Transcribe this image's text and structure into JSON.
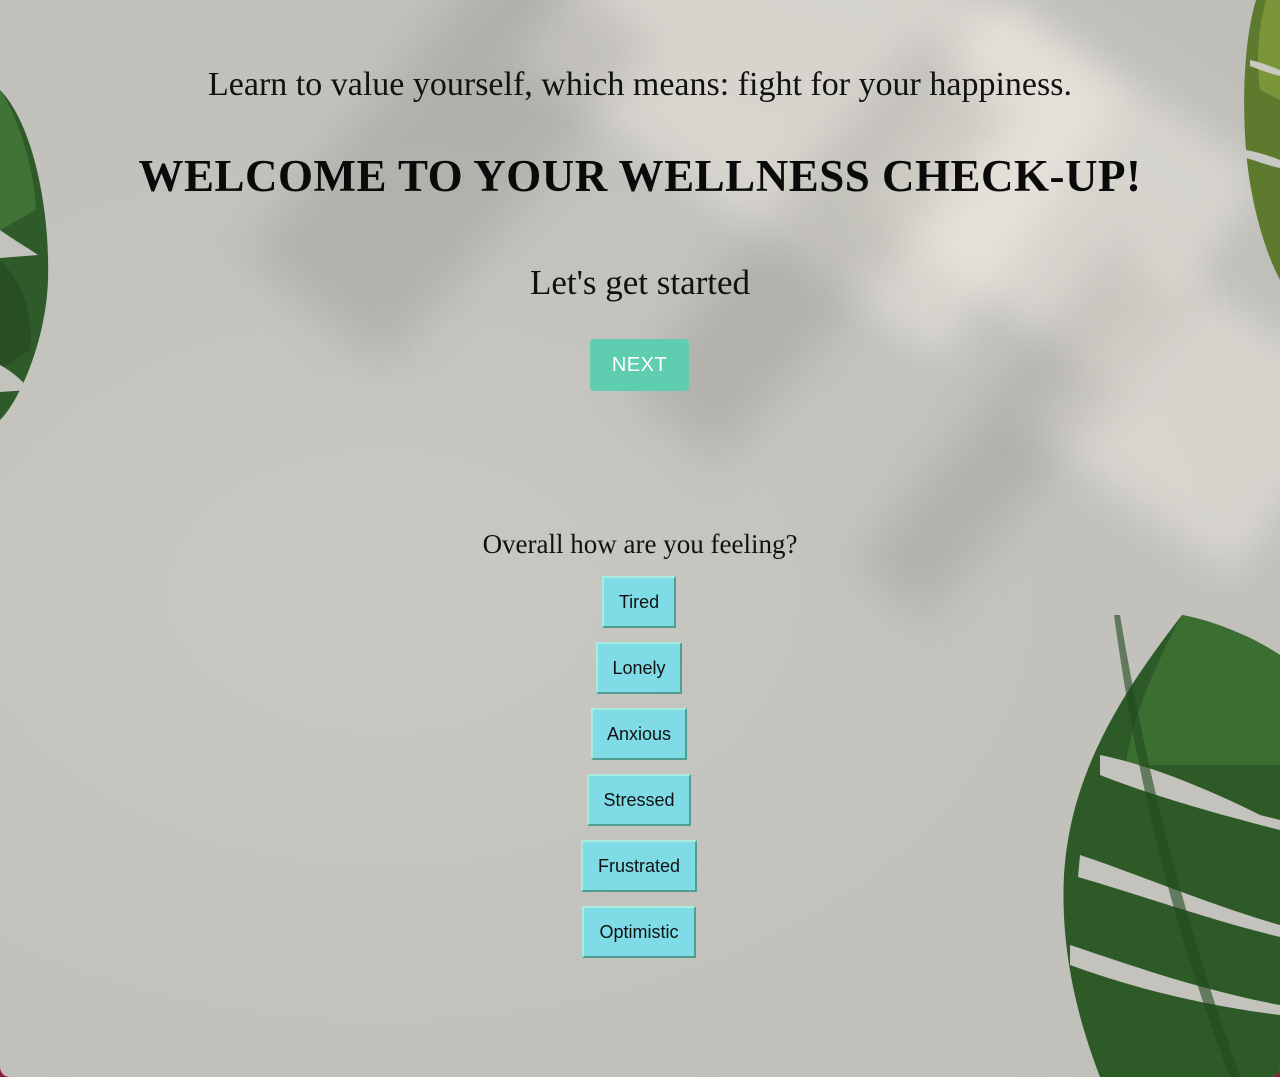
{
  "header": {
    "quote": "Learn to value yourself, which means: fight for your happiness.",
    "title": "WELCOME TO YOUR WELLNESS CHECK-UP!",
    "subtitle": "Let's get started"
  },
  "actions": {
    "next_label": "NEXT"
  },
  "feelings": {
    "question": "Overall how are you feeling?",
    "options": [
      "Tired",
      "Lonely",
      "Anxious",
      "Stressed",
      "Frustrated",
      "Optimistic"
    ]
  },
  "colors": {
    "next_button": "#5fceb0",
    "feeling_button": "#7fdce6",
    "leaf": "#2f5a2a"
  },
  "decorations": [
    "monstera-leaf-top-left",
    "monstera-leaf-top-right",
    "monstera-leaf-bottom-right"
  ]
}
